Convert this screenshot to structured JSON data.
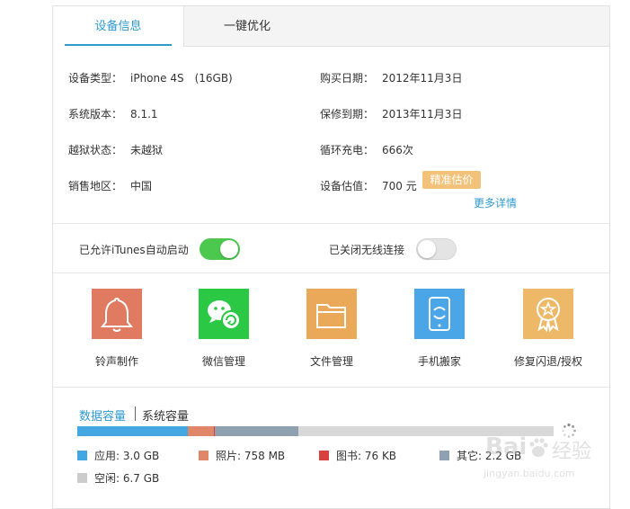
{
  "tabs": {
    "device_info": "设备信息",
    "optimize": "一键优化"
  },
  "device": {
    "left": [
      {
        "label": "设备类型：",
        "value": "iPhone 4S　(16GB)"
      },
      {
        "label": "系统版本：",
        "value": "8.1.1"
      },
      {
        "label": "越狱状态：",
        "value": "未越狱"
      },
      {
        "label": "销售地区：",
        "value": "中国"
      }
    ],
    "right": [
      {
        "label": "购买日期：",
        "value": "2012年11月3日"
      },
      {
        "label": "保修到期：",
        "value": "2013年11月3日"
      },
      {
        "label": "循环充电：",
        "value": "666次"
      },
      {
        "label": "设备估值：",
        "value": "700 元"
      }
    ],
    "estimate_button": "精准估价",
    "more_link": "更多详情"
  },
  "toggles": {
    "itunes_label": "已允许iTunes自动启动",
    "itunes_on": true,
    "wireless_label": "已关闭无线连接",
    "wireless_on": false
  },
  "tools": [
    {
      "label": "铃声制作",
      "icon": "bell-icon",
      "color": "#e07b61"
    },
    {
      "label": "微信管理",
      "icon": "wechat-icon",
      "color": "#2ac845"
    },
    {
      "label": "文件管理",
      "icon": "folder-icon",
      "color": "#eaa959"
    },
    {
      "label": "手机搬家",
      "icon": "phone-transfer-icon",
      "color": "#4aa6e6"
    },
    {
      "label": "修复闪退/授权",
      "icon": "repair-badge-icon",
      "color": "#edb968"
    }
  ],
  "storage": {
    "tab_data": "数据容量",
    "tab_system": "系统容量",
    "segments": [
      {
        "name": "应用",
        "fraction": 0.232,
        "color": "#43a7e2"
      },
      {
        "name": "照片",
        "fraction": 0.055,
        "color": "#e0876a"
      },
      {
        "name": "图书",
        "fraction": 0.002,
        "color": "#d94040"
      },
      {
        "name": "其它",
        "fraction": 0.176,
        "color": "#8fa1b1"
      }
    ],
    "free_color": "#d8d8d8",
    "legend": [
      {
        "text": "应用: 3.0 GB",
        "color": "#43a7e2"
      },
      {
        "text": "照片: 758 MB",
        "color": "#e0876a"
      },
      {
        "text": "图书: 76 KB",
        "color": "#d94040"
      },
      {
        "text": "其它: 2.2 GB",
        "color": "#8fa1b1"
      },
      {
        "text": "空闲: 6.7 GB",
        "color": "#cccccc"
      }
    ]
  },
  "watermark": {
    "brand": "Bai",
    "cn": "经验",
    "url": "jingyan.baidu.com"
  }
}
